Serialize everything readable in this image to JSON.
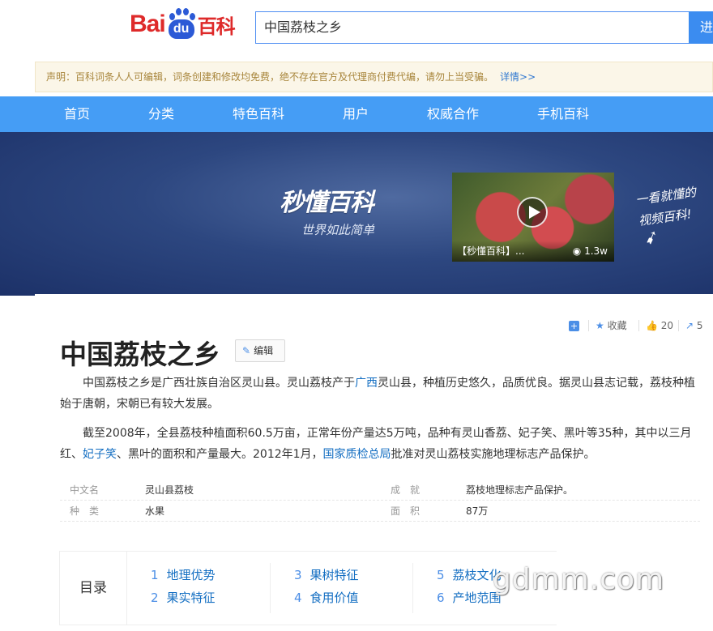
{
  "header": {
    "logo": {
      "bai": "Bai",
      "du": "du",
      "baike": "百科"
    },
    "search": {
      "value": "中国荔枝之乡"
    },
    "search_button": "进"
  },
  "notice": {
    "text": "声明：百科词条人人可编辑，词条创建和修改均免费，绝不存在官方及代理商付费代编，请勿上当受骗。",
    "link": "详情>>"
  },
  "nav": {
    "items": [
      "首页",
      "分类",
      "特色百科",
      "用户",
      "权威合作",
      "手机百科"
    ]
  },
  "banner": {
    "title": "秒懂百科",
    "subtitle": "世界如此简单",
    "video_caption": "【秒懂百科】...",
    "video_views": "1.3w",
    "hand_note_line1": "一看就懂的",
    "hand_note_line2": "视频百科!"
  },
  "actions": {
    "collect": "收藏",
    "likes": "20",
    "share": "5"
  },
  "article": {
    "title": "中国荔枝之乡",
    "edit": "编辑",
    "p1": {
      "a": "中国荔枝之乡是广西壮族自治区灵山县。灵山荔枝产于",
      "link": "广西",
      "b": "灵山县，种植历史悠久，品质优良。据灵山县志记载，荔枝种植始于唐朝，宋朝已有较大发展。"
    },
    "p2": {
      "a": "截至2008年，全县荔枝种植面积60.5万亩，正常年份产量达5万吨，品种有灵山香荔、妃子笑、黑叶等35种，其中以三月红、",
      "link1": "妃子笑",
      "b": "、黑叶的面积和产量最大。2012年1月，",
      "link2": "国家质检总局",
      "c": "批准对灵山荔枝实施地理标志产品保护。"
    }
  },
  "infobox": {
    "rows": [
      {
        "k1": "中文名",
        "v1": "灵山县荔枝",
        "k2": "成　就",
        "v2": "荔枝地理标志产品保护。"
      },
      {
        "k1": "种　类",
        "v1": "水果",
        "k2": "面　积",
        "v2": "87万"
      }
    ]
  },
  "catalog": {
    "label": "目录",
    "items": [
      {
        "num": "1",
        "label": "地理优势"
      },
      {
        "num": "2",
        "label": "果实特征"
      },
      {
        "num": "3",
        "label": "果树特征"
      },
      {
        "num": "4",
        "label": "食用价值"
      },
      {
        "num": "5",
        "label": "荔枝文化"
      },
      {
        "num": "6",
        "label": "产地范围"
      }
    ]
  },
  "watermark": "gdmm.com"
}
